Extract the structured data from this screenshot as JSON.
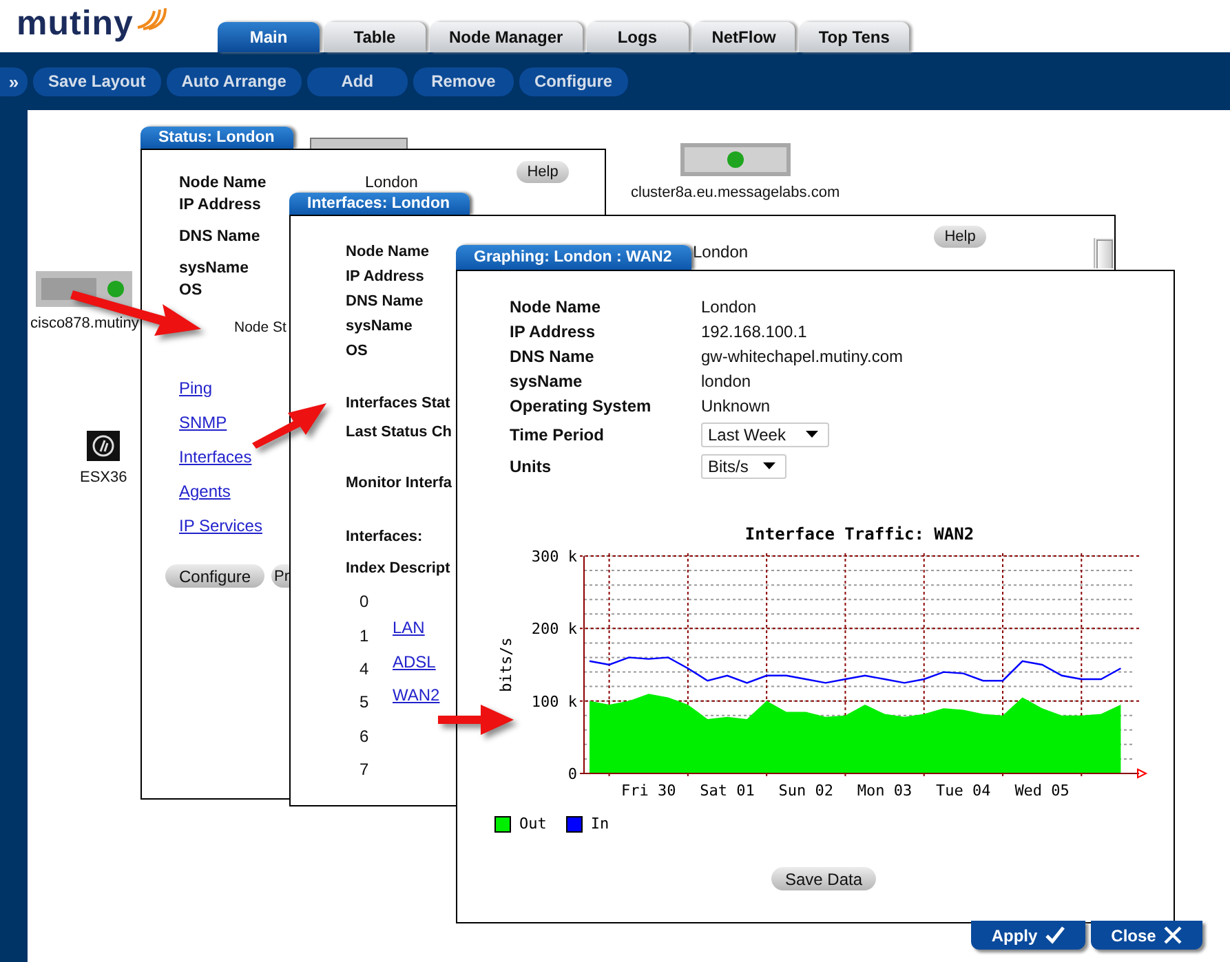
{
  "logo": "mutiny",
  "tabs": [
    {
      "label": "Main",
      "selected": true
    },
    {
      "label": "Table",
      "selected": false
    },
    {
      "label": "Node Manager",
      "selected": false
    },
    {
      "label": "Logs",
      "selected": false
    },
    {
      "label": "NetFlow",
      "selected": false
    },
    {
      "label": "Top Tens",
      "selected": false
    }
  ],
  "toolbar": {
    "expand": "»",
    "buttons": [
      "Save Layout",
      "Auto Arrange",
      "Add",
      "Remove",
      "Configure"
    ]
  },
  "desktop_nodes": [
    {
      "kind": "server",
      "label": "cluster8a.eu.messagelabs.com"
    },
    {
      "kind": "router",
      "label": "cisco878.mutiny"
    },
    {
      "kind": "hp",
      "label": "ESX36"
    }
  ],
  "status_window": {
    "title": "Status: London",
    "help": "Help",
    "fields": [
      {
        "label": "Node Name",
        "value": "London"
      },
      {
        "label": "IP Address"
      },
      {
        "label": "DNS Name"
      },
      {
        "label": "sysName"
      },
      {
        "label": "OS"
      }
    ],
    "node_status": "Node St",
    "links": [
      "Ping",
      "SNMP",
      "Interfaces",
      "Agents",
      "IP Services"
    ],
    "buttons": [
      "Configure",
      "Pr"
    ]
  },
  "interfaces_window": {
    "title": "Interfaces: London",
    "help": "Help",
    "fields": [
      {
        "label": "Node Name",
        "value": "London"
      },
      {
        "label": "IP Address"
      },
      {
        "label": "DNS Name"
      },
      {
        "label": "sysName"
      },
      {
        "label": "OS"
      }
    ],
    "status_labels": [
      "Interfaces Stat",
      "Last Status Ch"
    ],
    "monitor_label": "Monitor Interfa",
    "interfaces_label": "Interfaces:",
    "index_header": "Index Descript",
    "rows": [
      {
        "index": "0"
      },
      {
        "index": "1",
        "description": "LAN"
      },
      {
        "index": "4",
        "description": "ADSL"
      },
      {
        "index": "5",
        "description": "WAN2"
      },
      {
        "index": "6"
      },
      {
        "index": "7"
      }
    ]
  },
  "graph_window": {
    "title": "Graphing: London : WAN2",
    "fields": [
      {
        "label": "Node Name",
        "value": "London"
      },
      {
        "label": "IP Address",
        "value": "192.168.100.1"
      },
      {
        "label": "DNS Name",
        "value": "gw-whitechapel.mutiny.com"
      },
      {
        "label": "sysName",
        "value": "london"
      },
      {
        "label": "Operating System",
        "value": "Unknown"
      }
    ],
    "time_period": {
      "label": "Time Period",
      "value": "Last Week"
    },
    "units": {
      "label": "Units",
      "value": "Bits/s"
    },
    "chart_data": {
      "type": "area",
      "grid": true,
      "title": "Interface Traffic: WAN2",
      "ylabel": "bits/s",
      "ylim": [
        0,
        300
      ],
      "yticks": [
        {
          "value": 0,
          "label": "0"
        },
        {
          "value": 100,
          "label": "100 k"
        },
        {
          "value": 200,
          "label": "200 k"
        },
        {
          "value": 300,
          "label": "300 k"
        }
      ],
      "categories": [
        null,
        null,
        null,
        "Fri 30",
        null,
        null,
        null,
        "Sat 01",
        null,
        null,
        null,
        "Sun 02",
        null,
        null,
        null,
        "Mon 03",
        null,
        null,
        null,
        "Tue 04",
        null,
        null,
        null,
        "Wed 05",
        null,
        null,
        null,
        null
      ],
      "series": [
        {
          "name": "Out",
          "color": "#00ee00",
          "values": [
            100,
            95,
            100,
            110,
            105,
            95,
            75,
            78,
            75,
            100,
            85,
            85,
            78,
            80,
            95,
            82,
            78,
            82,
            90,
            88,
            82,
            80,
            105,
            90,
            80,
            80,
            82,
            95
          ]
        },
        {
          "name": "In",
          "color": "#0000ff",
          "type": "line",
          "values": [
            155,
            150,
            160,
            158,
            160,
            145,
            128,
            135,
            125,
            135,
            135,
            130,
            125,
            130,
            135,
            130,
            125,
            130,
            140,
            138,
            128,
            128,
            155,
            150,
            135,
            130,
            130,
            145
          ]
        }
      ]
    },
    "save_button": "Save Data"
  },
  "footer_buttons": [
    {
      "label": "Apply",
      "kind": "apply"
    },
    {
      "label": "Close",
      "kind": "close"
    }
  ]
}
